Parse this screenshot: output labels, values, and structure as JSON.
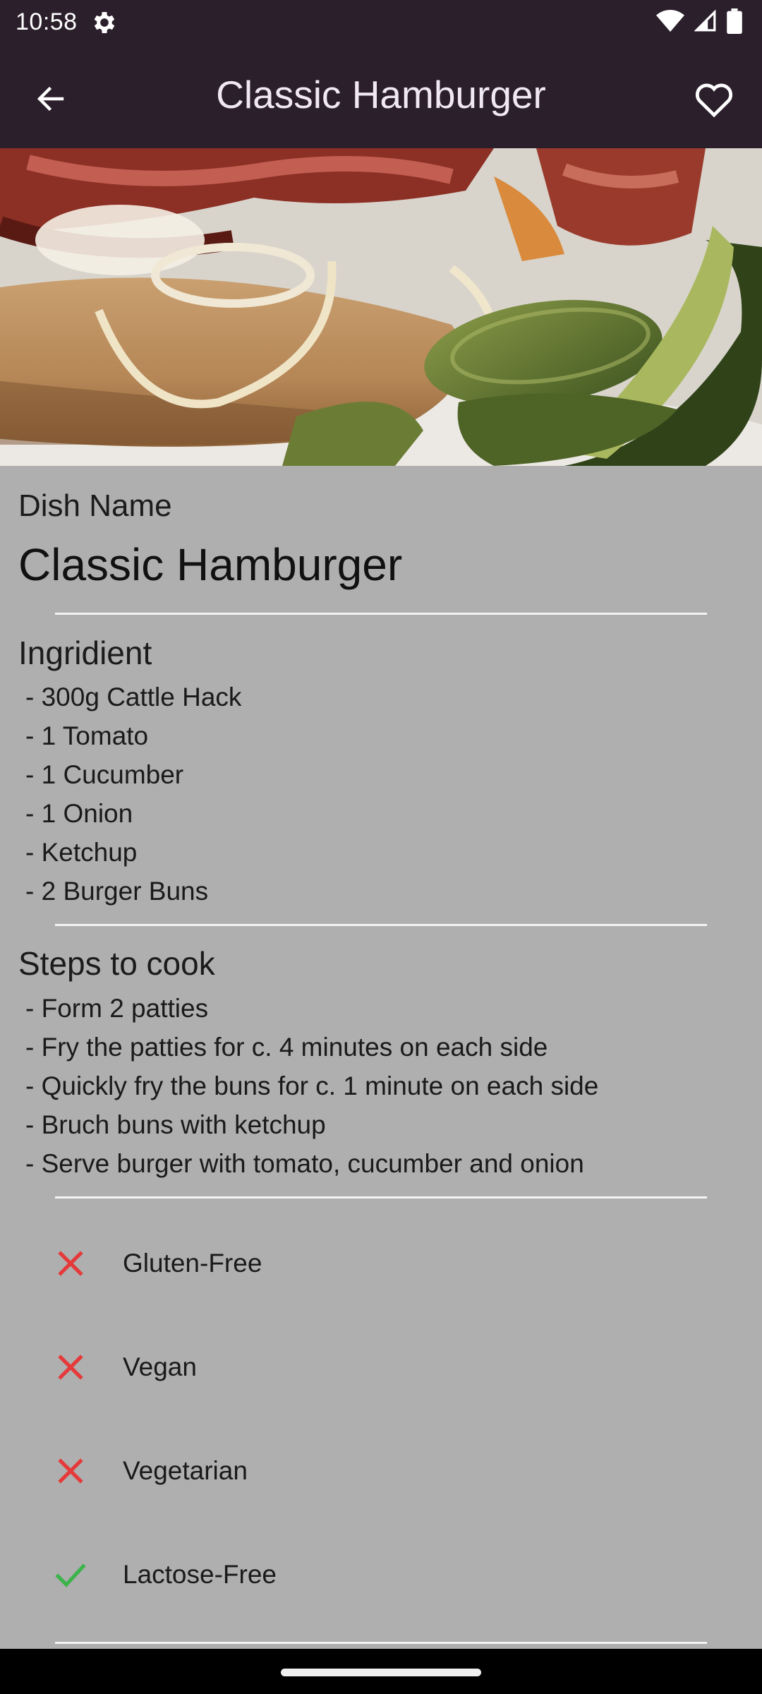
{
  "status_bar": {
    "time": "10:58"
  },
  "app_bar": {
    "title": "Classic Hamburger"
  },
  "hero_image": {
    "alt": "Classic Hamburger"
  },
  "dish": {
    "label": "Dish Name",
    "name": "Classic Hamburger"
  },
  "ingredients": {
    "heading": "Ingridient",
    "items": [
      " - 300g Cattle Hack",
      " - 1 Tomato",
      " - 1 Cucumber",
      " - 1 Onion",
      " - Ketchup",
      " - 2 Burger Buns"
    ]
  },
  "steps": {
    "heading": "Steps to cook",
    "items": [
      " - Form 2 patties",
      " - Fry the patties for c. 4 minutes on each side",
      " - Quickly fry the buns for c. 1 minute on each side",
      " - Bruch buns with ketchup",
      " - Serve burger with tomato, cucumber and onion"
    ]
  },
  "diet": [
    {
      "label": "Gluten-Free",
      "value": false
    },
    {
      "label": "Vegan",
      "value": false
    },
    {
      "label": "Vegetarian",
      "value": false
    },
    {
      "label": "Lactose-Free",
      "value": true
    }
  ],
  "colors": {
    "app_bar": "#2b1f2b",
    "background": "#afafaf",
    "no_icon": "#e5393a",
    "yes_icon": "#3cb44b"
  }
}
